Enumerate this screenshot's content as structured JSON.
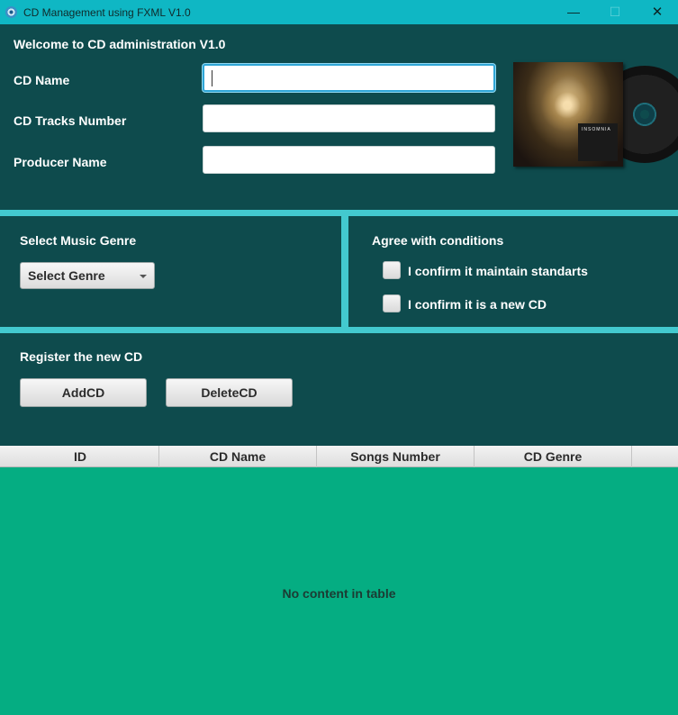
{
  "window": {
    "title": "CD Management using FXML V1.0",
    "controls": {
      "minimize": "—",
      "maximize": "☐",
      "close": "✕"
    }
  },
  "form": {
    "welcome": "Welcome to CD administration V1.0",
    "cd_name_label": "CD Name",
    "cd_name_value": "",
    "tracks_label": "CD Tracks Number",
    "tracks_value": "",
    "producer_label": "Producer Name",
    "producer_value": "",
    "cover_text": "INSOMNIA"
  },
  "genre": {
    "section_label": "Select Music Genre",
    "combo_value": "Select Genre"
  },
  "conditions": {
    "section_label": "Agree with conditions",
    "checks": [
      {
        "label": "I confirm it maintain standarts",
        "checked": false
      },
      {
        "label": "I confirm it is a new CD",
        "checked": false
      }
    ]
  },
  "register": {
    "section_label": "Register the new CD",
    "add_label": "AddCD",
    "delete_label": "DeleteCD"
  },
  "table": {
    "columns": [
      "ID",
      "CD Name",
      "Songs Number",
      "CD Genre"
    ],
    "rows": [],
    "placeholder": "No content in table"
  },
  "colors": {
    "titlebar": "#0fb7c4",
    "panel": "#0e4b4d",
    "divider": "#43c9cf",
    "table_bg": "#05ad82"
  }
}
